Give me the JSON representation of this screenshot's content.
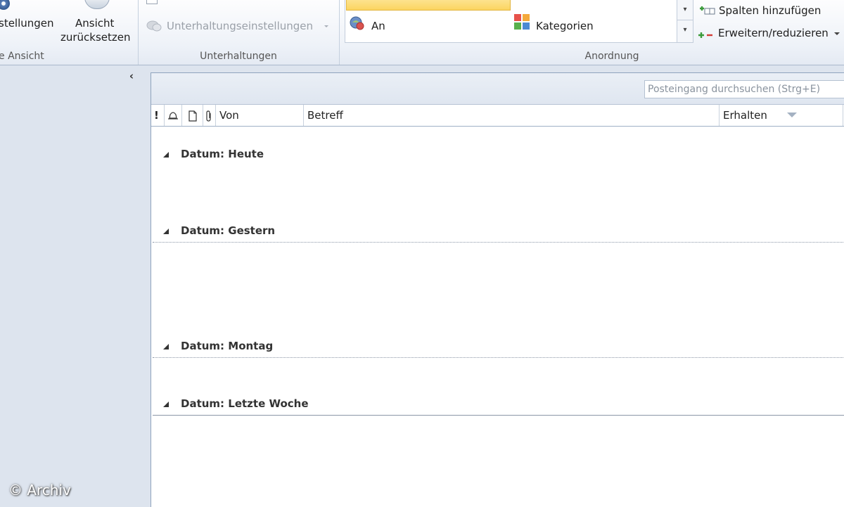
{
  "ribbon": {
    "current_view": {
      "settings_label": "stellungen",
      "reset_line1": "Ansicht",
      "reset_line2": "zurücksetzen",
      "group_label": "e Ansicht"
    },
    "conversations": {
      "settings_label": "Unterhaltungseinstellungen",
      "group_label": "Unterhaltungen"
    },
    "arrangement": {
      "to_label": "An",
      "categories_label": "Kategorien",
      "add_columns_label": "Spalten hinzufügen",
      "expand_collapse_label": "Erweitern/reduzieren",
      "group_label": "Anordnung"
    }
  },
  "search": {
    "placeholder": "Posteingang durchsuchen (Strg+E)"
  },
  "columns": {
    "importance": "!",
    "from": "Von",
    "subject": "Betreff",
    "received": "Erhalten"
  },
  "groups": [
    {
      "label": "Datum: Heute"
    },
    {
      "label": "Datum: Gestern"
    },
    {
      "label": "Datum: Montag"
    },
    {
      "label": "Datum: Letzte Woche"
    }
  ],
  "watermark": "© Archiv",
  "colors": {
    "accent_highlight": "#fbd560",
    "pane_background": "#dde4ee"
  }
}
